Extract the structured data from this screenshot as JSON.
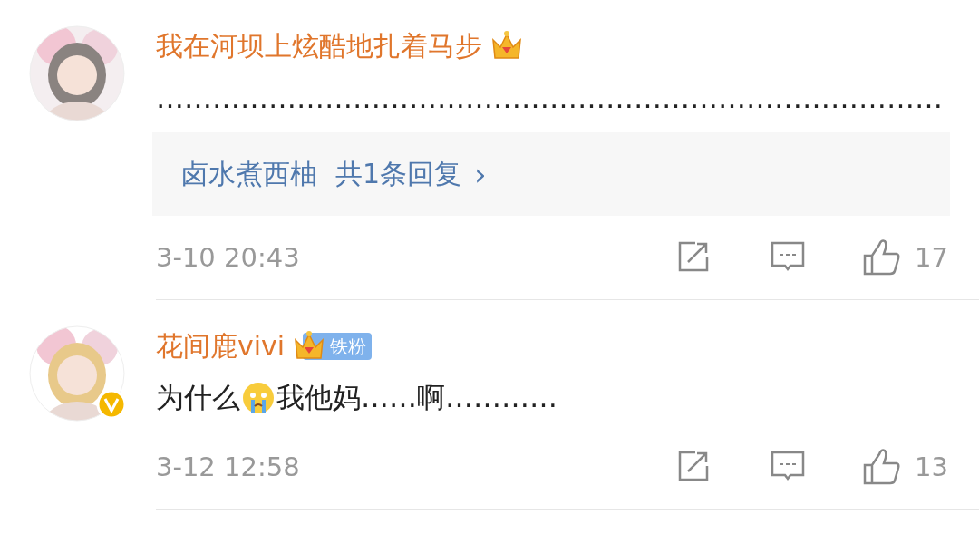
{
  "comments": [
    {
      "author": "我在河坝上炫酷地扎着马步",
      "verified": false,
      "text_parts": [
        {
          "kind": "text",
          "text": "…………………………………………………………………………"
        }
      ],
      "replies": {
        "author": "卤水煮西柚",
        "count": "共1条回复",
        "chevron": "›"
      },
      "time": "3-10 20:43",
      "likes": "17"
    },
    {
      "author": "花间鹿vivi",
      "verified": true,
      "fan_badge": "铁粉",
      "text_parts": [
        {
          "kind": "text",
          "text": "为什么"
        },
        {
          "kind": "emoji"
        },
        {
          "kind": "text",
          "text": "我他妈……啊…………"
        }
      ],
      "time": "3-12 12:58",
      "likes": "13"
    }
  ]
}
